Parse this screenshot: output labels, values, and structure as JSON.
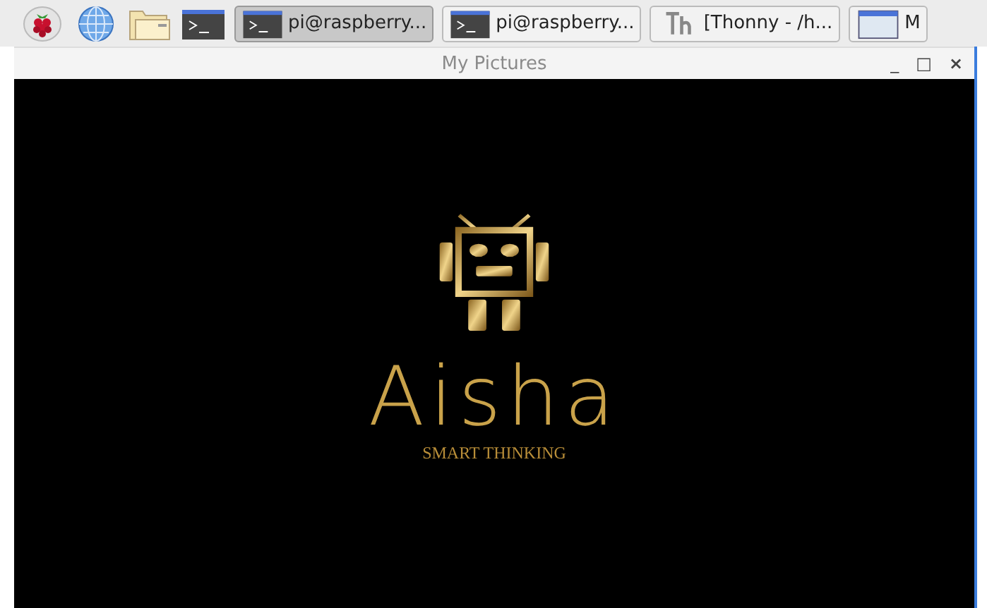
{
  "taskbar": {
    "launchers": [
      {
        "kind": "raspberry"
      },
      {
        "kind": "globe"
      },
      {
        "kind": "folder"
      },
      {
        "kind": "terminal"
      }
    ],
    "tasks": [
      {
        "kind": "terminal",
        "label": "pi@raspberry...",
        "selected": true
      },
      {
        "kind": "terminal",
        "label": "pi@raspberry...",
        "selected": false
      },
      {
        "kind": "thonny",
        "label": "[Thonny  -  /h...",
        "selected": false
      },
      {
        "kind": "window",
        "label": "M",
        "selected": false
      }
    ]
  },
  "window": {
    "title": "My Pictures",
    "controls": [
      {
        "kind": "minimize",
        "label": "_"
      },
      {
        "kind": "maximize",
        "label": "□"
      },
      {
        "kind": "close",
        "label": "×"
      }
    ]
  },
  "image": {
    "name": "Aisha",
    "tagline": "SMART THINKING"
  }
}
